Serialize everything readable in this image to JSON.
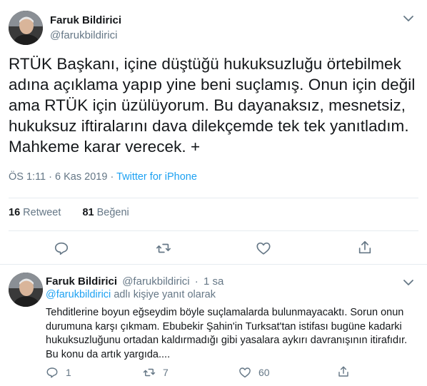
{
  "main_tweet": {
    "author_name": "Faruk Bildirici",
    "author_handle": "@farukbildirici",
    "text": "RTÜK Başkanı, içine düştüğü hukuksuzluğu örtebilmek adına açıklama yapıp yine beni suçlamış. Onun için değil ama RTÜK için üzülüyorum. Bu dayanaksız, mesnetsiz, hukuksuz iftiralarını dava dilekçemde tek tek yanıtladım. Mahkeme karar verecek. +",
    "time": "ÖS 1:11",
    "date": "6 Kas 2019",
    "meta_separator": "·",
    "source": "Twitter for iPhone",
    "retweet_count": "16",
    "retweet_label": "Retweet",
    "like_count": "81",
    "like_label": "Beğeni"
  },
  "reply_tweet": {
    "author_name": "Faruk Bildirici",
    "author_handle": "@farukbildirici",
    "separator": "·",
    "age": "1 sa",
    "reply_to_handle": "@farukbildirici",
    "reply_to_suffix": "adlı kişiye yanıt olarak",
    "text": "Tehditlerine boyun eğseydim böyle suçlamalarda bulunmayacaktı. Sorun onun durumuna karşı çıkmam. Ebubekir Şahin'in Turksat'tan istifası bugüne kadarki hukuksuzluğunu ortadan kaldırmadığı gibi yasalara aykırı davranışının itirafıdır. Bu konu da artık yargıda....",
    "reply_count": "1",
    "retweet_count": "7",
    "like_count": "60"
  },
  "colors": {
    "text": "#14171a",
    "secondary": "#657786",
    "link": "#1da1f2",
    "divider": "#e6ecf0"
  },
  "icons": [
    "chevron-down-icon",
    "reply-icon",
    "retweet-icon",
    "like-icon",
    "share-icon"
  ]
}
